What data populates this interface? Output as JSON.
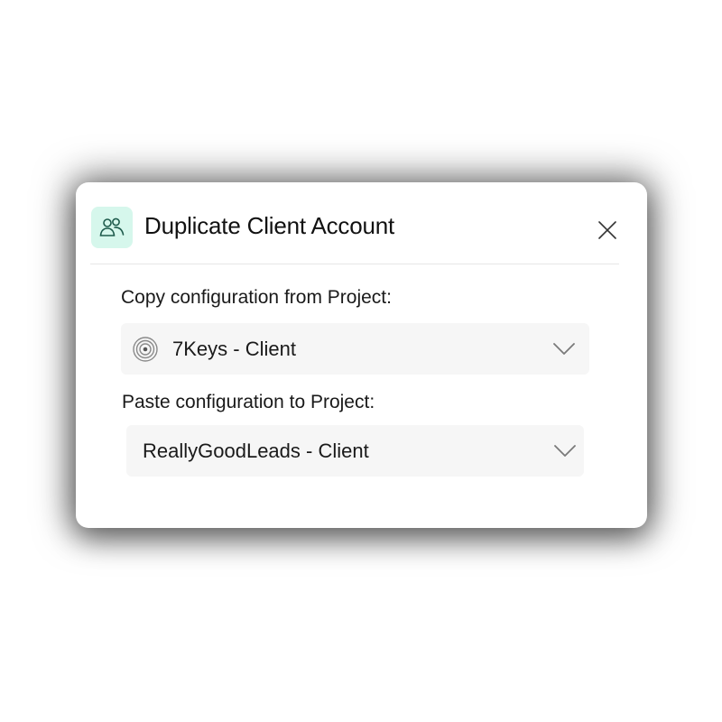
{
  "dialog": {
    "title": "Duplicate Client Account",
    "header_icon": "users-icon",
    "close_icon": "close-icon"
  },
  "source": {
    "label": "Copy configuration from Project:",
    "selected": "7Keys - Client",
    "project_icon": "concentric-circles-icon",
    "chevron_icon": "chevron-down-icon"
  },
  "target": {
    "label": "Paste configuration to Project:",
    "selected": "ReallyGoodLeads - Client",
    "chevron_icon": "chevron-down-icon"
  },
  "colors": {
    "accent_bg": "#d6f7ec",
    "accent_icon": "#1e5b4c",
    "select_bg": "#f6f6f6"
  }
}
